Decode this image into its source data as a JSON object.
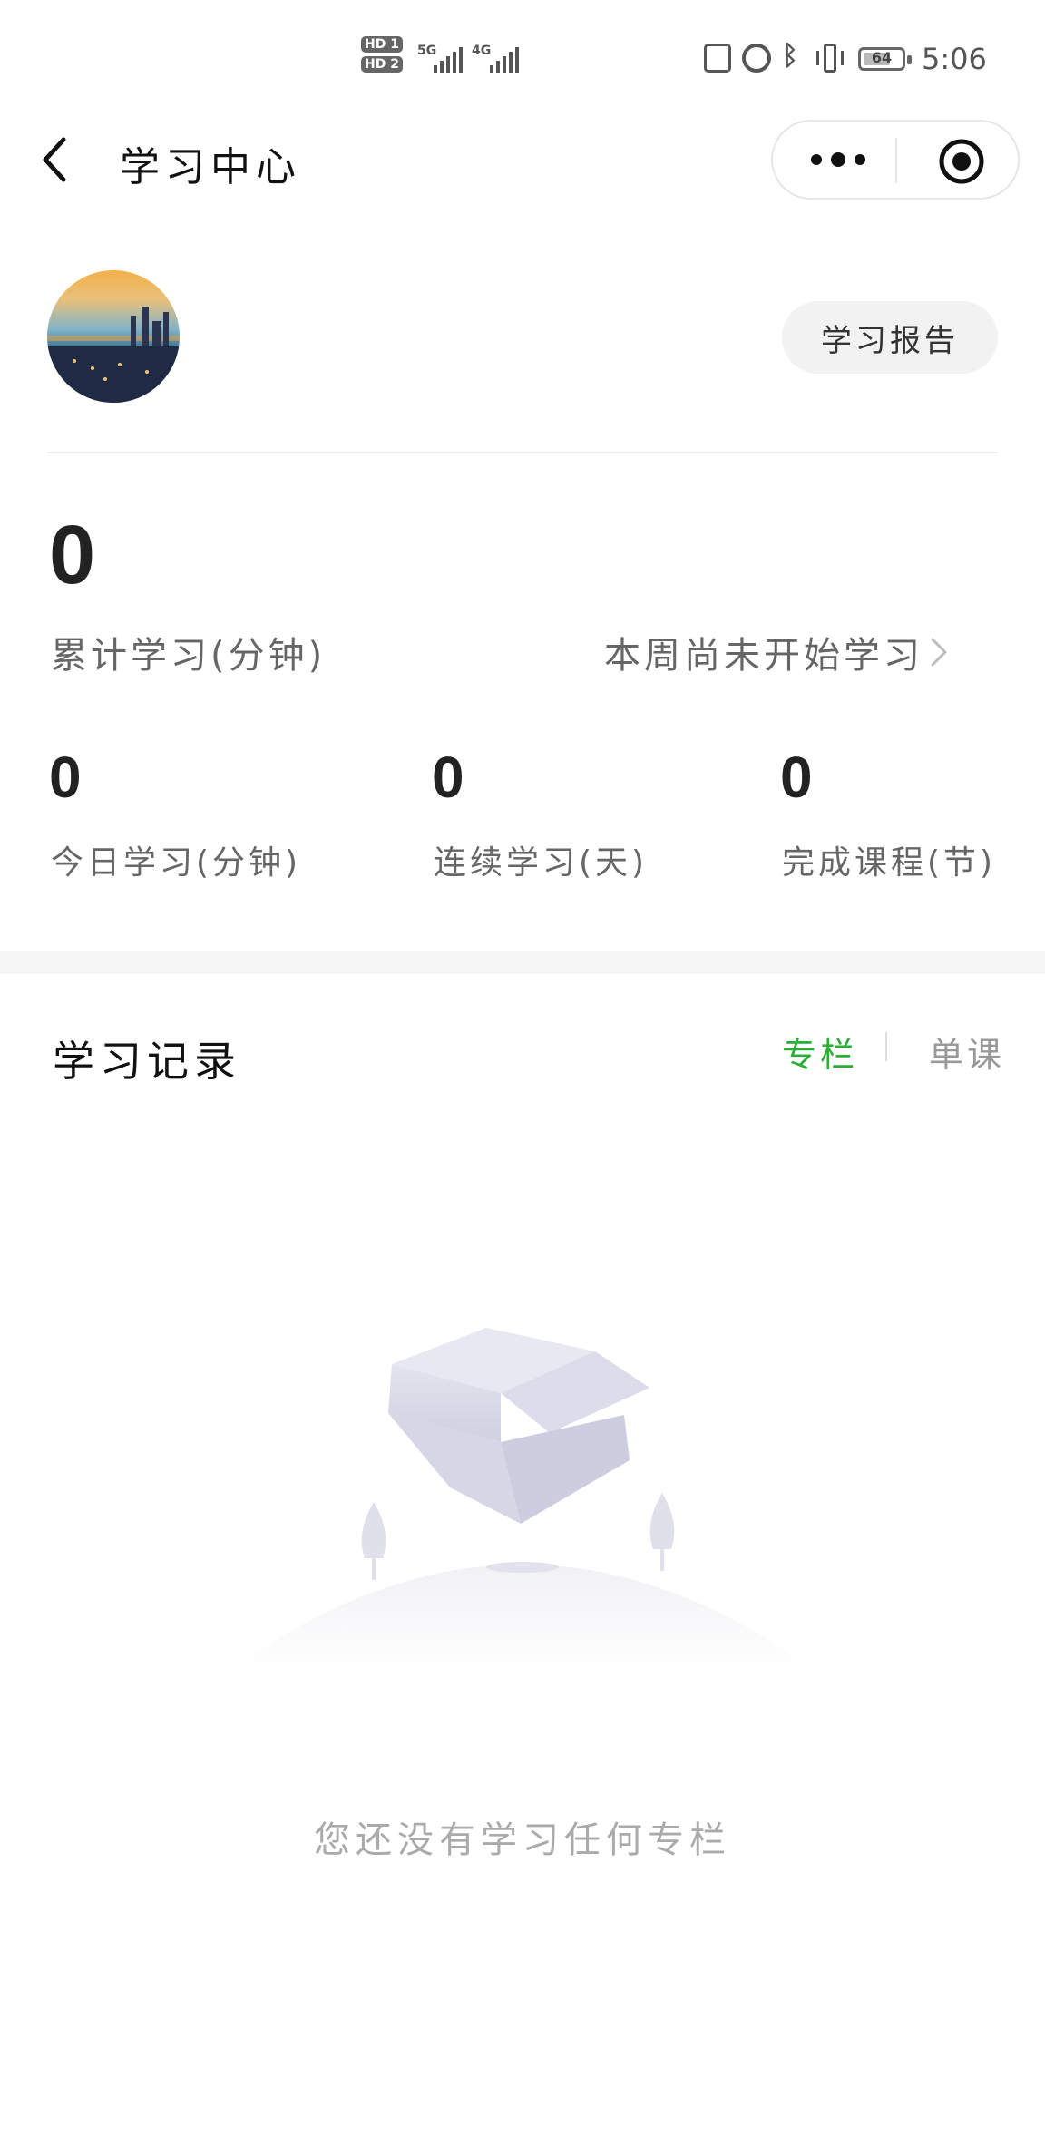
{
  "status_bar": {
    "hd1": "HD 1",
    "hd2": "HD 2",
    "net1": "5G",
    "net2": "4G",
    "battery": "64",
    "time": "5:06"
  },
  "nav": {
    "title": "学习中心"
  },
  "profile": {
    "report_button": "学习报告"
  },
  "stats": {
    "total_value": "0",
    "total_label": "累计学习(分钟)",
    "week_link": "本周尚未开始学习",
    "today_value": "0",
    "today_label": "今日学习(分钟)",
    "streak_value": "0",
    "streak_label": "连续学习(天)",
    "completed_value": "0",
    "completed_label": "完成课程(节)"
  },
  "records": {
    "title": "学习记录",
    "tabs": [
      "专栏",
      "单课"
    ],
    "active_tab": 0,
    "empty_text": "您还没有学习任何专栏"
  },
  "colors": {
    "accent": "#2bae35",
    "muted": "#999999",
    "pill_bg": "#f2f2f2"
  }
}
